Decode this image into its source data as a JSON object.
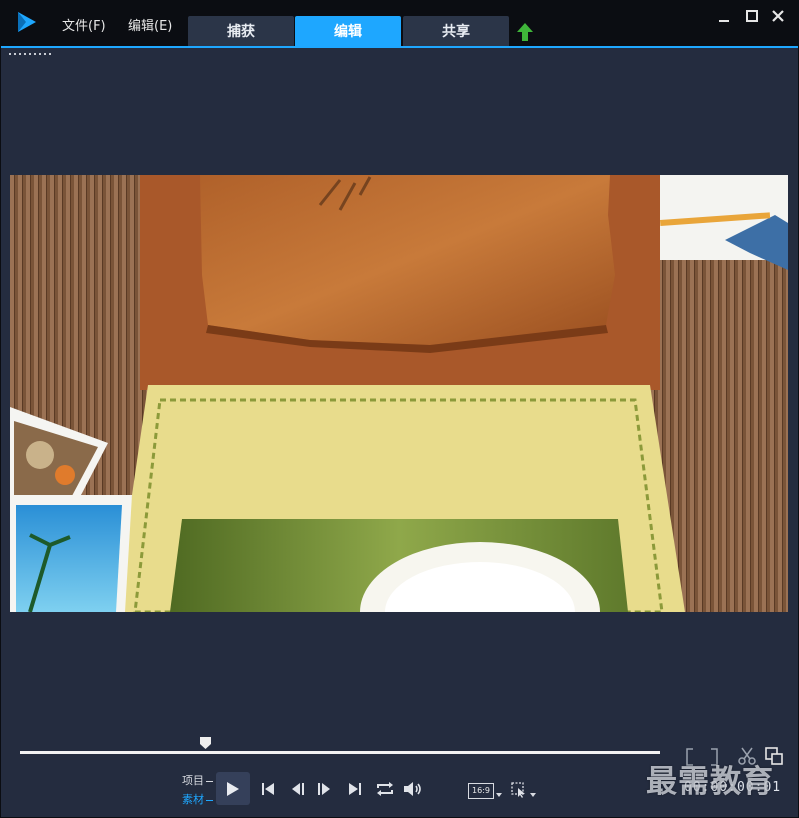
{
  "menu": {
    "file": "文件(F)",
    "edit": "编辑(E)"
  },
  "tabs": [
    {
      "label": "捕获"
    },
    {
      "label": "编辑",
      "active": true
    },
    {
      "label": "共享"
    }
  ],
  "icons": {
    "logo": "app-logo-icon",
    "upload": "upload-arrow-icon",
    "minimize": "minimize-icon",
    "maximize": "maximize-icon",
    "close": "close-icon",
    "play": "play-icon",
    "scissors": "scissors-icon"
  },
  "colors": {
    "accent": "#1ea7ff",
    "background": "#242c3f",
    "titlebar": "#0b0d12",
    "upload": "#3fb53a"
  },
  "playback": {
    "mode_project": "项目",
    "mode_clip": "素材",
    "aspect_ratio": "16:9",
    "position": 0.29,
    "timecode": "00:00:00:01"
  },
  "watermark": "最需教育"
}
